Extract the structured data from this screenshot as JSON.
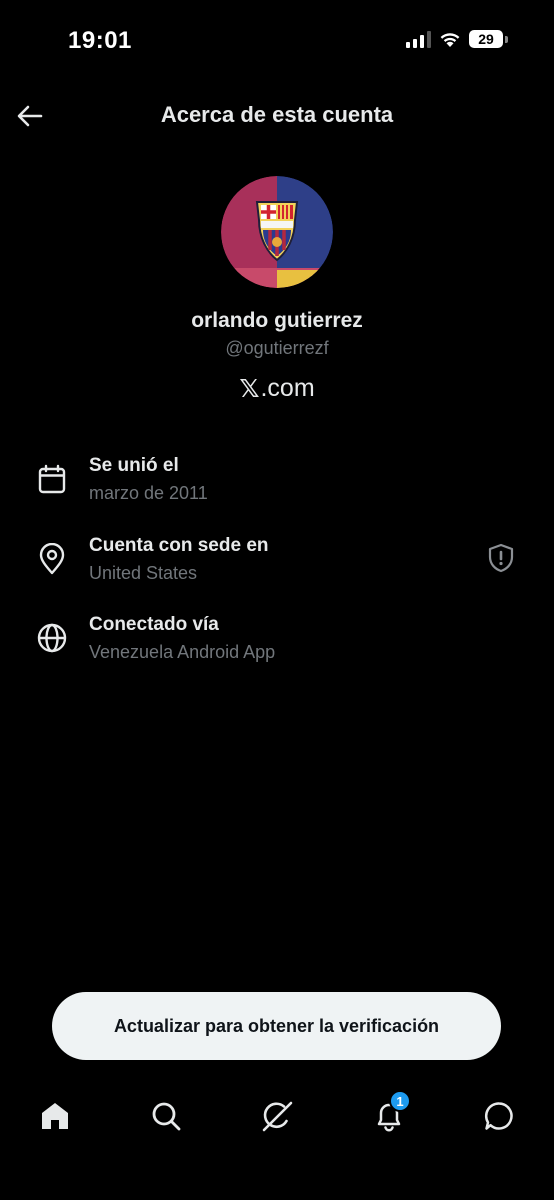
{
  "status_bar": {
    "time": "19:01",
    "battery": "29"
  },
  "header": {
    "title": "Acerca de esta cuenta",
    "back_icon": "arrow-left-icon"
  },
  "profile": {
    "display_name": "orlando gutierrez",
    "handle": "@ogutierrezf",
    "domain_mark": "𝕏",
    "domain_text": ".com",
    "avatar_icon": "fc-barcelona-crest-avatar"
  },
  "info": [
    {
      "icon": "calendar-icon",
      "label": "Se unió el",
      "value": "marzo de 2011"
    },
    {
      "icon": "location-pin-icon",
      "label": "Cuenta con sede en",
      "value": "United States",
      "extra_icon": "shield-icon"
    },
    {
      "icon": "globe-icon",
      "label": "Conectado vía",
      "value": "Venezuela Android App"
    }
  ],
  "cta": {
    "label": "Actualizar para obtener la verificación"
  },
  "tabs": [
    {
      "name": "home",
      "icon": "home-icon"
    },
    {
      "name": "search",
      "icon": "search-icon"
    },
    {
      "name": "grok",
      "icon": "grok-icon"
    },
    {
      "name": "notifications",
      "icon": "bell-icon",
      "badge": "1"
    },
    {
      "name": "messages",
      "icon": "message-icon"
    }
  ],
  "colors": {
    "background": "#000000",
    "text": "#e7e9ea",
    "muted": "#71767b",
    "accent": "#1d9bf0",
    "cta_bg": "#eff3f4"
  }
}
